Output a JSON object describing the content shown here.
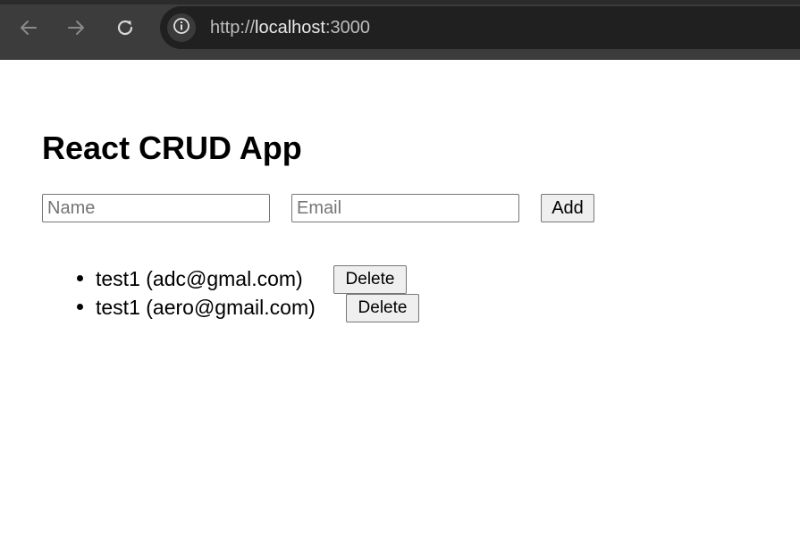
{
  "browser": {
    "url_scheme": "http://",
    "url_host": "localhost",
    "url_port": ":3000",
    "icons": {
      "back": "arrow-left-icon",
      "forward": "arrow-right-icon",
      "reload": "reload-icon",
      "site_info": "info-icon"
    }
  },
  "app": {
    "title": "React CRUD App",
    "name_input": {
      "value": "",
      "placeholder": "Name"
    },
    "email_input": {
      "value": "",
      "placeholder": "Email"
    },
    "add_label": "Add",
    "users": [
      {
        "text": "test1 (adc@gmal.com)",
        "delete_label": "Delete"
      },
      {
        "text": "test1 (aero@gmail.com)",
        "delete_label": "Delete"
      }
    ]
  },
  "colors": {
    "toolbar_bg": "#3c3c3c",
    "omnibox_bg": "#202020",
    "button_bg": "#efefef"
  }
}
